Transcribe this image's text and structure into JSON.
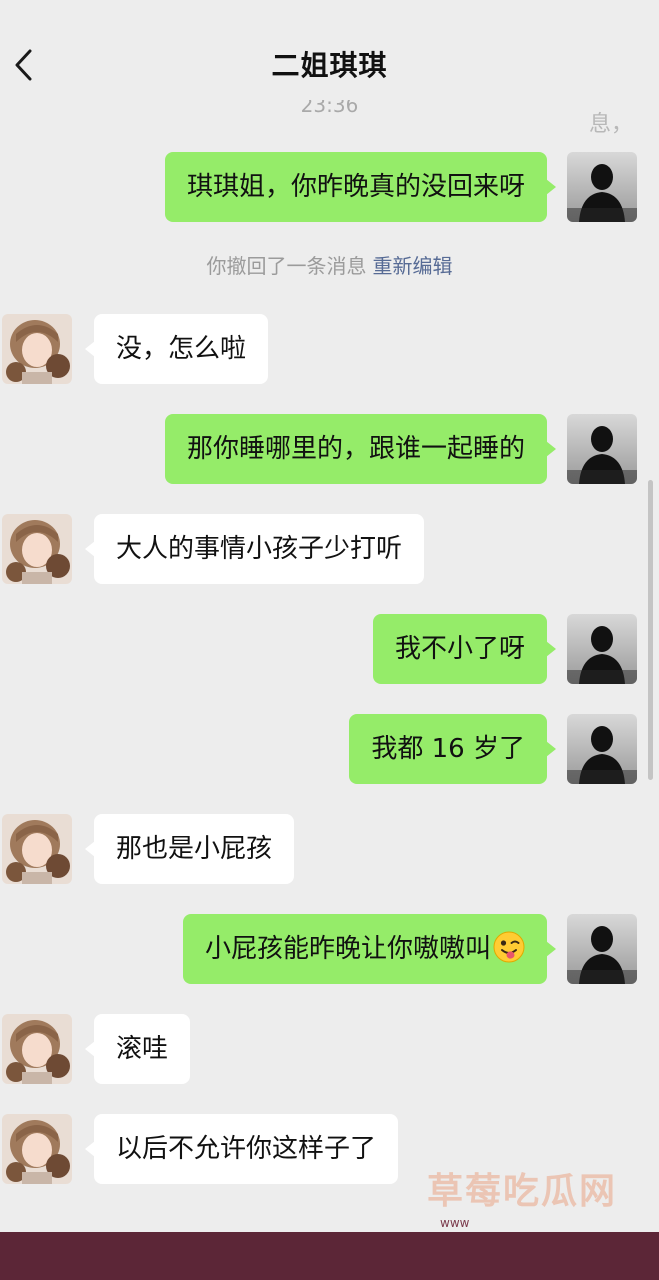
{
  "header": {
    "title": "二姐琪琪",
    "back_icon": "chevron-left-icon"
  },
  "chat": {
    "timestamp": "23:36",
    "recall_notice": "你撤回了一条消息",
    "recall_action": "重新编辑",
    "messages": [
      {
        "sender": "me",
        "text": "琪琪姐，你昨晚真的没回来呀"
      },
      {
        "sender": "her",
        "text": "没，怎么啦"
      },
      {
        "sender": "me",
        "text": "那你睡哪里的，跟谁一起睡的"
      },
      {
        "sender": "her",
        "text": "大人的事情小孩子少打听"
      },
      {
        "sender": "me",
        "text": "我不小了呀"
      },
      {
        "sender": "me",
        "text": "我都 16 岁了"
      },
      {
        "sender": "her",
        "text": "那也是小屁孩"
      },
      {
        "sender": "me",
        "text": "小屁孩能昨晚让你嗷嗷叫",
        "emoji": "winking-face-tongue-icon"
      },
      {
        "sender": "her",
        "text": "滚哇"
      },
      {
        "sender": "her",
        "text": "以后不允许你这样子了"
      }
    ]
  },
  "overlay": {
    "corner_fragment": "息，",
    "watermark": "草莓吃瓜网",
    "watermark_sub": "www"
  },
  "colors": {
    "background": "#ededed",
    "my_bubble": "#95ec69",
    "her_bubble": "#ffffff",
    "link": "#576b95",
    "bottom_bar": "#5c2637"
  }
}
